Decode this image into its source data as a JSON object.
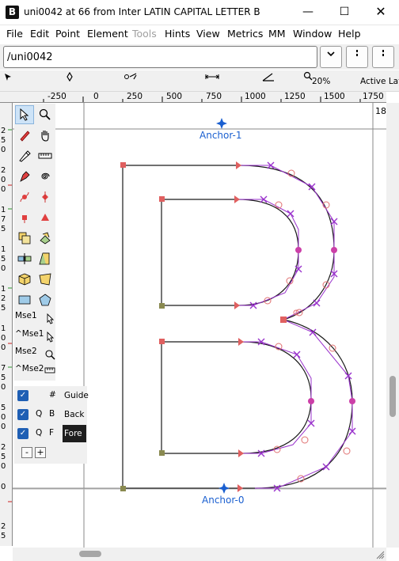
{
  "window": {
    "app_icon": "B",
    "title": "uni0042 at 66 from Inter LATIN CAPITAL LETTER B",
    "minimize": "—",
    "maximize": "☐",
    "close": "✕"
  },
  "menu": [
    "File",
    "Edit",
    "Point",
    "Element",
    "Tools",
    "Hints",
    "View",
    "Metrics",
    "MM",
    "Window",
    "Help"
  ],
  "menu_disabled": [
    "Tools"
  ],
  "glyph_field": {
    "value": "/uni0042"
  },
  "nav_buttons": [
    "chevron-down-icon",
    "prev-glyph-icon",
    "next-glyph-icon"
  ],
  "info_bar": {
    "zoom": "20%",
    "active_layer": "Active Lay"
  },
  "ruler_labels": [
    "-250",
    "0",
    "250",
    "500",
    "750",
    "1000",
    "1250",
    "1500",
    "1750"
  ],
  "corner_number": "18",
  "tool_palette": {
    "mse1": "Mse1",
    "cmse1": "^Mse1",
    "mse2": "Mse2",
    "cmse2": "^Mse2"
  },
  "layers": [
    {
      "checked": true,
      "col1": "#",
      "col2": "",
      "name": "Guide"
    },
    {
      "checked": true,
      "col1": "Q",
      "col2": "B",
      "name": "Back"
    },
    {
      "checked": true,
      "col1": "Q",
      "col2": "F",
      "name": "Fore",
      "selected": true
    }
  ],
  "layer_buttons": {
    "remove": "-",
    "add": "+"
  },
  "anchors": [
    {
      "name": "Anchor-1"
    },
    {
      "name": "Anchor-0"
    }
  ],
  "colors": {
    "outline": "#1a1a1a",
    "control_line": "#8a2be2",
    "anchor": "#1a5fd0",
    "point_corner": "#e05050",
    "point_curve": "#cc2fa0",
    "guide": "#7a7a7a"
  }
}
